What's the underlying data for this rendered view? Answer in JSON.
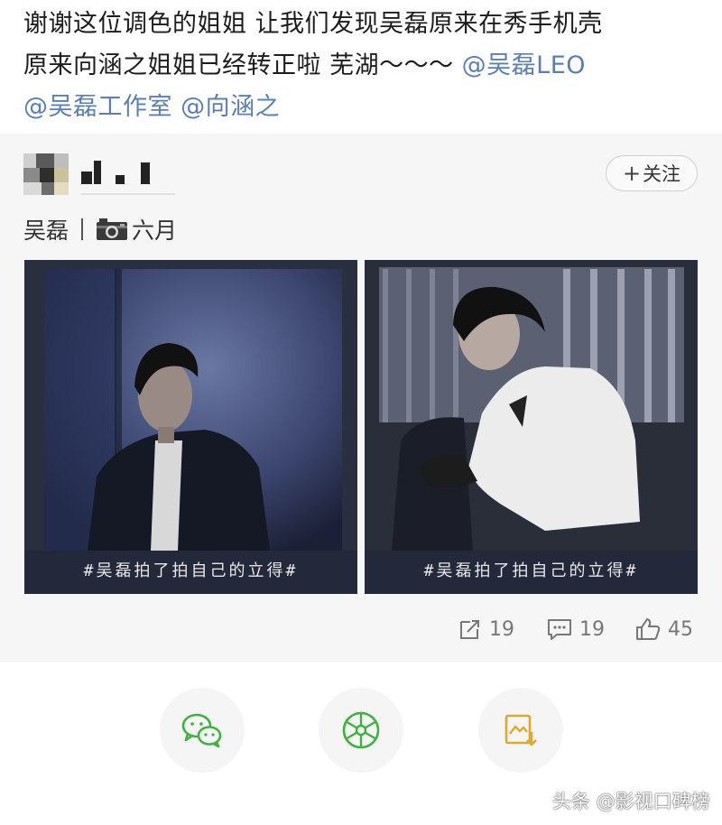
{
  "post": {
    "line1": "谢谢这位调色的姐姐 让我们发现吴磊原来在秀手机壳",
    "line2_text": "原来向涵之姐姐已经转正啦 芜湖～～～ ",
    "mention1": "@吴磊LEO",
    "mention2": "@吴磊工作室",
    "mention3": "@向涵之"
  },
  "card": {
    "follow_label": "关注",
    "follow_icon": "plus-icon",
    "author_line": {
      "name": "吴磊",
      "camera_icon": "camera-icon",
      "location": "六月"
    },
    "photos": [
      {
        "caption": "#吴磊拍了拍自己的立得#",
        "description_icon": "photo-left"
      },
      {
        "caption": "#吴磊拍了拍自己的立得#",
        "description_icon": "photo-right"
      }
    ],
    "stats": {
      "reposts": "19",
      "comments": "19",
      "likes": "45"
    }
  },
  "share": [
    {
      "icon": "wechat-icon"
    },
    {
      "icon": "moments-icon"
    },
    {
      "icon": "save-image-icon"
    }
  ],
  "watermark": "头条 @影视口碑榜",
  "colors": {
    "mention": "#5b7fb5",
    "share_green": "#3fb33f",
    "share_yellow": "#e0a92a"
  }
}
